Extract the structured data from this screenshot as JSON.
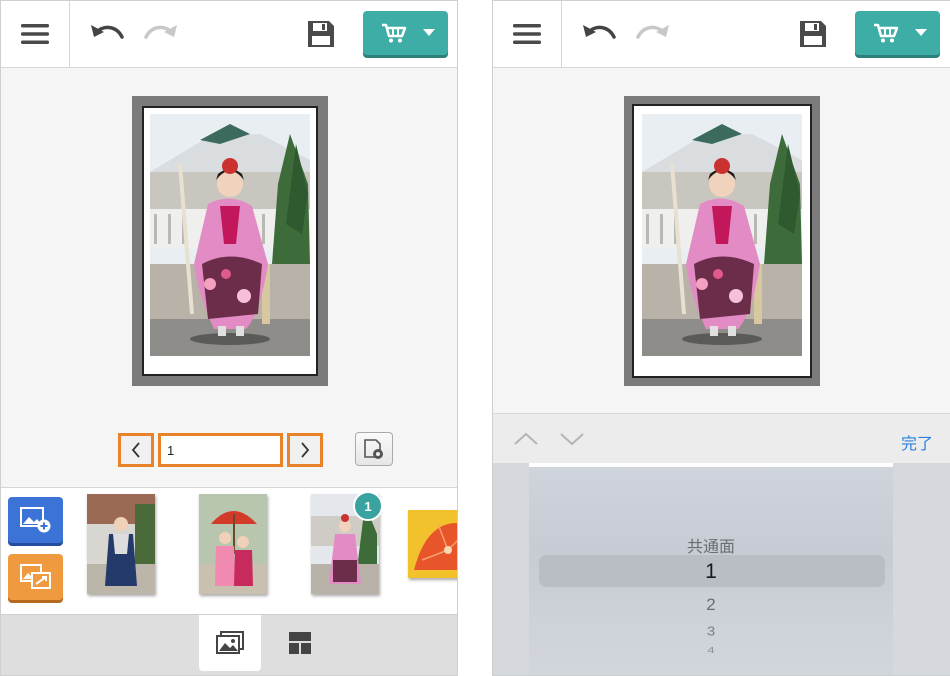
{
  "left_screen": {
    "topbar": {
      "menu_icon": "hamburger-icon",
      "undo_icon": "undo-icon",
      "redo_icon": "redo-icon",
      "save_icon": "floppy-disk-icon",
      "cart_icon": "cart-icon",
      "cart_dropdown_icon": "caret-down-icon"
    },
    "pager": {
      "prev_icon": "chevron-left-icon",
      "page_value": "1",
      "next_icon": "chevron-right-icon",
      "settings_icon": "page-settings-icon"
    },
    "tray": {
      "add_photo_icon": "add-photo-icon",
      "swap_photo_icon": "replace-photo-icon",
      "thumbnails": [
        {
          "name": "thumb-boy-hakama",
          "used_count": ""
        },
        {
          "name": "thumb-girls-umbrella",
          "used_count": ""
        },
        {
          "name": "thumb-girl-kimono",
          "used_count": "1"
        },
        {
          "name": "thumb-umbrella-yellow",
          "used_count": ""
        }
      ]
    },
    "bottom_tabs": [
      {
        "icon": "photos-icon",
        "active": true
      },
      {
        "icon": "layout-icon",
        "active": false
      }
    ]
  },
  "right_screen": {
    "picker": {
      "up_icon": "chevron-up-icon",
      "down_icon": "chevron-down-icon",
      "done_label": "完了",
      "options": [
        "共通面",
        "1",
        "2",
        "3",
        "4"
      ],
      "selected": "1"
    }
  },
  "colors": {
    "accent_teal": "#3dada6",
    "add_blue": "#3b73d6",
    "swap_orange": "#ef9a3f",
    "pager_outline": "#e8832a",
    "done_blue": "#2a7fe0"
  }
}
